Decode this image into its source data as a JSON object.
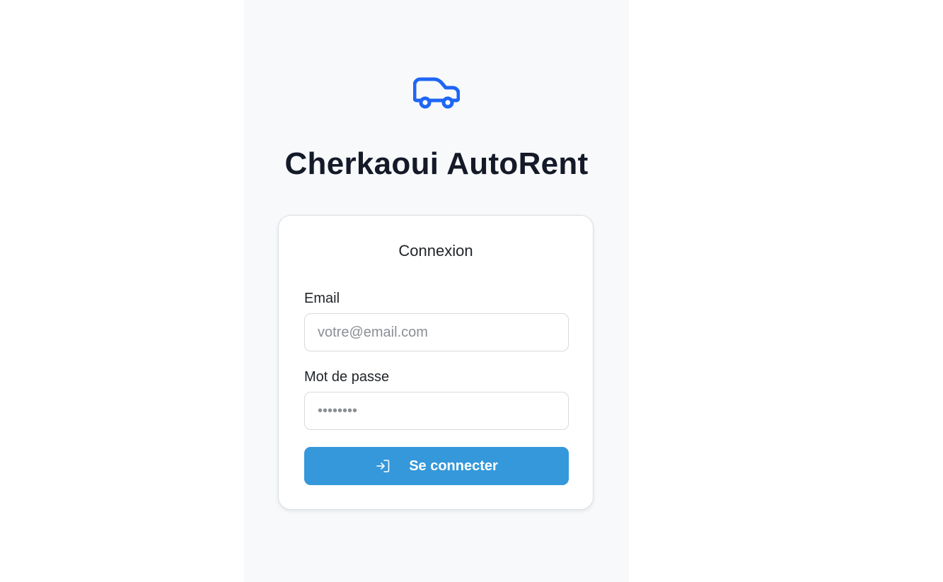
{
  "brand": {
    "title": "Cherkaoui AutoRent",
    "logo_icon": "car-icon",
    "accent_color": "#1e66f5"
  },
  "login": {
    "heading": "Connexion",
    "email": {
      "label": "Email",
      "placeholder": "votre@email.com",
      "value": ""
    },
    "password": {
      "label": "Mot de passe",
      "placeholder": "••••••••",
      "value": ""
    },
    "submit": {
      "label": "Se connecter",
      "icon": "login-icon",
      "color": "#3498db"
    }
  }
}
